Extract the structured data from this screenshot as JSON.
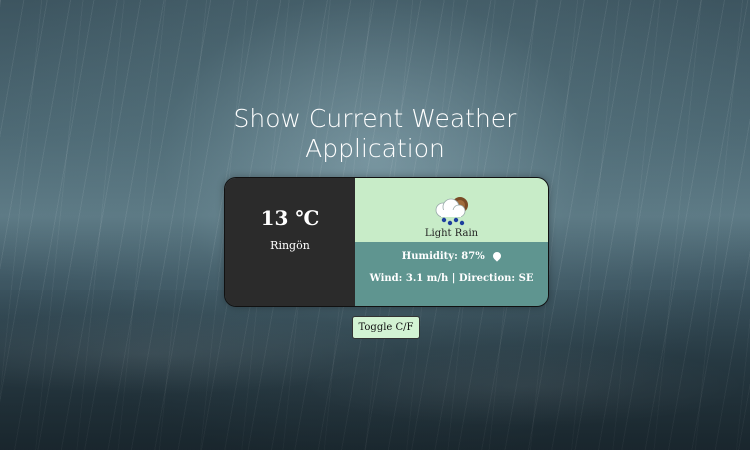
{
  "page": {
    "title_line1": "Show Current Weather",
    "title_line2": "Application"
  },
  "weather": {
    "temperature": "13 ℃",
    "city": "Ringön",
    "condition": "Light Rain",
    "condition_icon": "cloud-rain-icon",
    "humidity_label": "Humidity:",
    "humidity_value": "87%",
    "wind_label": "Wind:",
    "wind_value": "3.1 m/h",
    "separator": "|",
    "direction_label": "Direction:",
    "direction_value": "SE"
  },
  "controls": {
    "toggle_label": "Toggle C/F"
  },
  "colors": {
    "card_left": "#2b2b2b",
    "condition_bg": "#c8ecc8",
    "details_bg": "#5f9590",
    "button_bg": "#d3f3d3"
  }
}
